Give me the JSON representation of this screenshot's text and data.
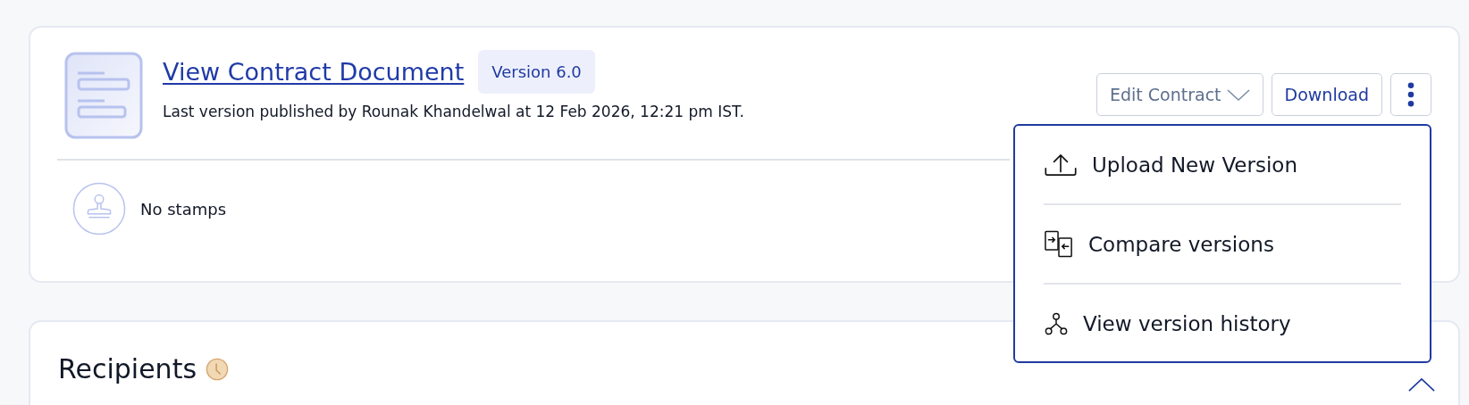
{
  "document_card": {
    "title": "View Contract Document",
    "version_badge": "Version 6.0",
    "published_note": "Last version published by Rounak Khandelwal at 12 Feb 2026, 12:21 pm IST.",
    "stamps_label": "No stamps",
    "buttons": [
      {
        "kind": "dropdown",
        "label": "Edit Contract"
      },
      {
        "kind": "plain",
        "label": "Download"
      },
      {
        "kind": "more"
      }
    ],
    "menu": [
      {
        "kind": "upload",
        "label": "Upload New Version"
      },
      {
        "kind": "compare",
        "label": "Compare versions"
      },
      {
        "kind": "history",
        "label": "View version history"
      }
    ]
  },
  "recipients_card": {
    "title": "Recipients",
    "expanded": true
  }
}
